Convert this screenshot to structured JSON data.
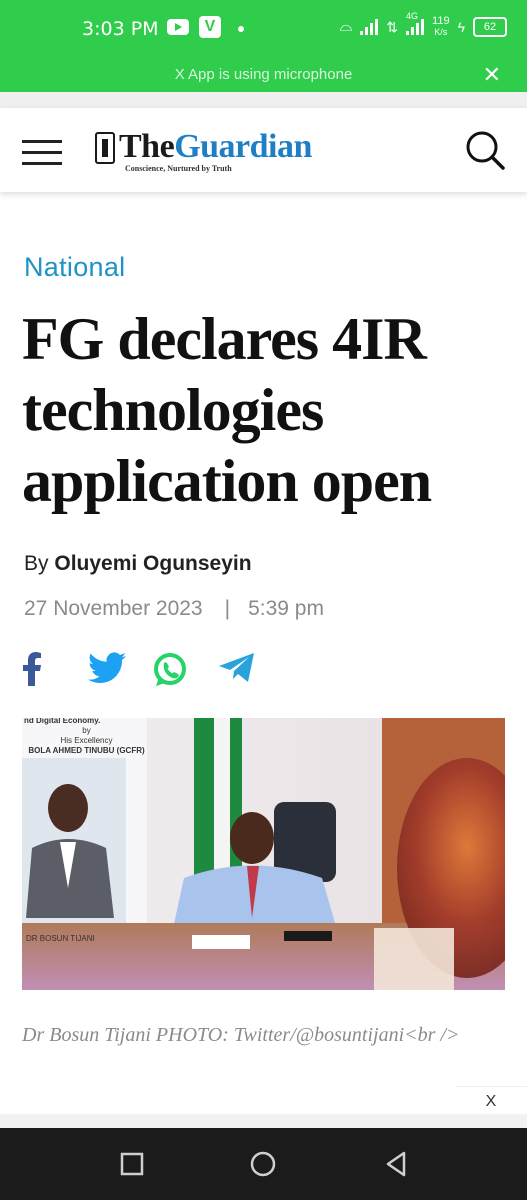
{
  "status_bar": {
    "time": "3:03 PM",
    "app_icon_v": "V",
    "network": "4G",
    "speed": "119",
    "speed_unit": "K/s",
    "battery": "62"
  },
  "mic_banner": {
    "text": "X App is using microphone",
    "close_label": "✕"
  },
  "header": {
    "logo_the": "The",
    "logo_guardian": "Guardian",
    "tagline": "Conscience, Nurtured by Truth"
  },
  "article": {
    "section": "National",
    "title": "FG declares 4IR technologies application open",
    "byline_prefix": "By",
    "author": "Oluyemi Ogunseyin",
    "date": "27 November 2023",
    "separator": "|",
    "time": "5:39 pm",
    "share_icons": [
      "facebook-icon",
      "twitter-icon",
      "whatsapp-icon",
      "telegram-icon"
    ],
    "photo_banner_line1": "nd Digital Economy.",
    "photo_banner_line2": "by",
    "photo_banner_line3": "His Excellency",
    "photo_banner_line4": "BOLA AHMED TINUBU (GCFR)",
    "photo_poster_name": "DR BOSUN TIJANI",
    "caption": "Dr Bosun Tijani PHOTO: Twitter/@bosuntijani<br />"
  },
  "ad": {
    "close_label": "X"
  },
  "colors": {
    "status_green": "#2fcd4b",
    "brand_blue": "#1e7fc5",
    "section_blue": "#1e93c6",
    "facebook": "#3b5998",
    "twitter": "#1da1f2",
    "whatsapp": "#25d366",
    "telegram": "#2aa3dc"
  }
}
